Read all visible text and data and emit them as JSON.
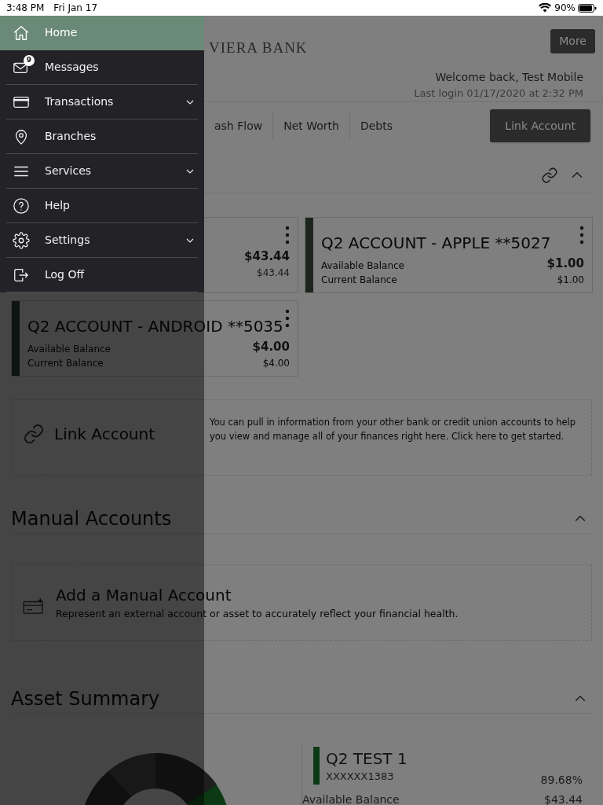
{
  "status_bar": {
    "time": "3:48 PM",
    "date": "Fri Jan 17",
    "battery": "90%"
  },
  "drawer": {
    "items": [
      {
        "label": "Home",
        "selected": true,
        "expandable": false
      },
      {
        "label": "Messages",
        "selected": false,
        "expandable": false,
        "badge": "9"
      },
      {
        "label": "Transactions",
        "selected": false,
        "expandable": true
      },
      {
        "label": "Branches",
        "selected": false,
        "expandable": false
      },
      {
        "label": "Services",
        "selected": false,
        "expandable": true
      },
      {
        "label": "Help",
        "selected": false,
        "expandable": false
      },
      {
        "label": "Settings",
        "selected": false,
        "expandable": true
      },
      {
        "label": "Log Off",
        "selected": false,
        "expandable": false
      }
    ]
  },
  "header": {
    "bank_name": "VIERA BANK",
    "more_button": "More",
    "welcome": "Welcome back, Test Mobile",
    "last_login": "Last login 01/17/2020 at 2:32 PM"
  },
  "tabs": [
    {
      "label": "ash Flow",
      "selected": false
    },
    {
      "label": "Net Worth",
      "selected": false
    },
    {
      "label": "Debts",
      "selected": false
    }
  ],
  "link_account_button": "Link Account",
  "accounts": [
    {
      "kind": "clipped",
      "available": "$43.44",
      "current": "$43.44"
    },
    {
      "kind": "full",
      "name": "Q2 ACCOUNT - APPLE **5027",
      "available_label": "Available Balance",
      "current_label": "Current Balance",
      "available": "$1.00",
      "current": "$1.00"
    },
    {
      "kind": "full",
      "name": "Q2 ACCOUNT - ANDROID **5035",
      "available_label": "Available Balance",
      "current_label": "Current Balance",
      "available": "$4.00",
      "current": "$4.00"
    }
  ],
  "link_tile": {
    "title": "Link Account",
    "text": "You can pull in information from your other bank or credit union accounts to help you view and manage all of your finances right here. Click here to get started."
  },
  "manual_accounts": {
    "heading": "Manual Accounts",
    "tile_title": "Add a Manual Account",
    "tile_text": "Represent an external account or asset to accurately reflect your financial health."
  },
  "asset_summary": {
    "heading": "Asset Summary",
    "legend": {
      "name": "Q2 TEST 1",
      "number": "XXXXXX1383",
      "percent": "89.68%",
      "balance_label": "Available Balance",
      "balance": "$43.44"
    }
  }
}
